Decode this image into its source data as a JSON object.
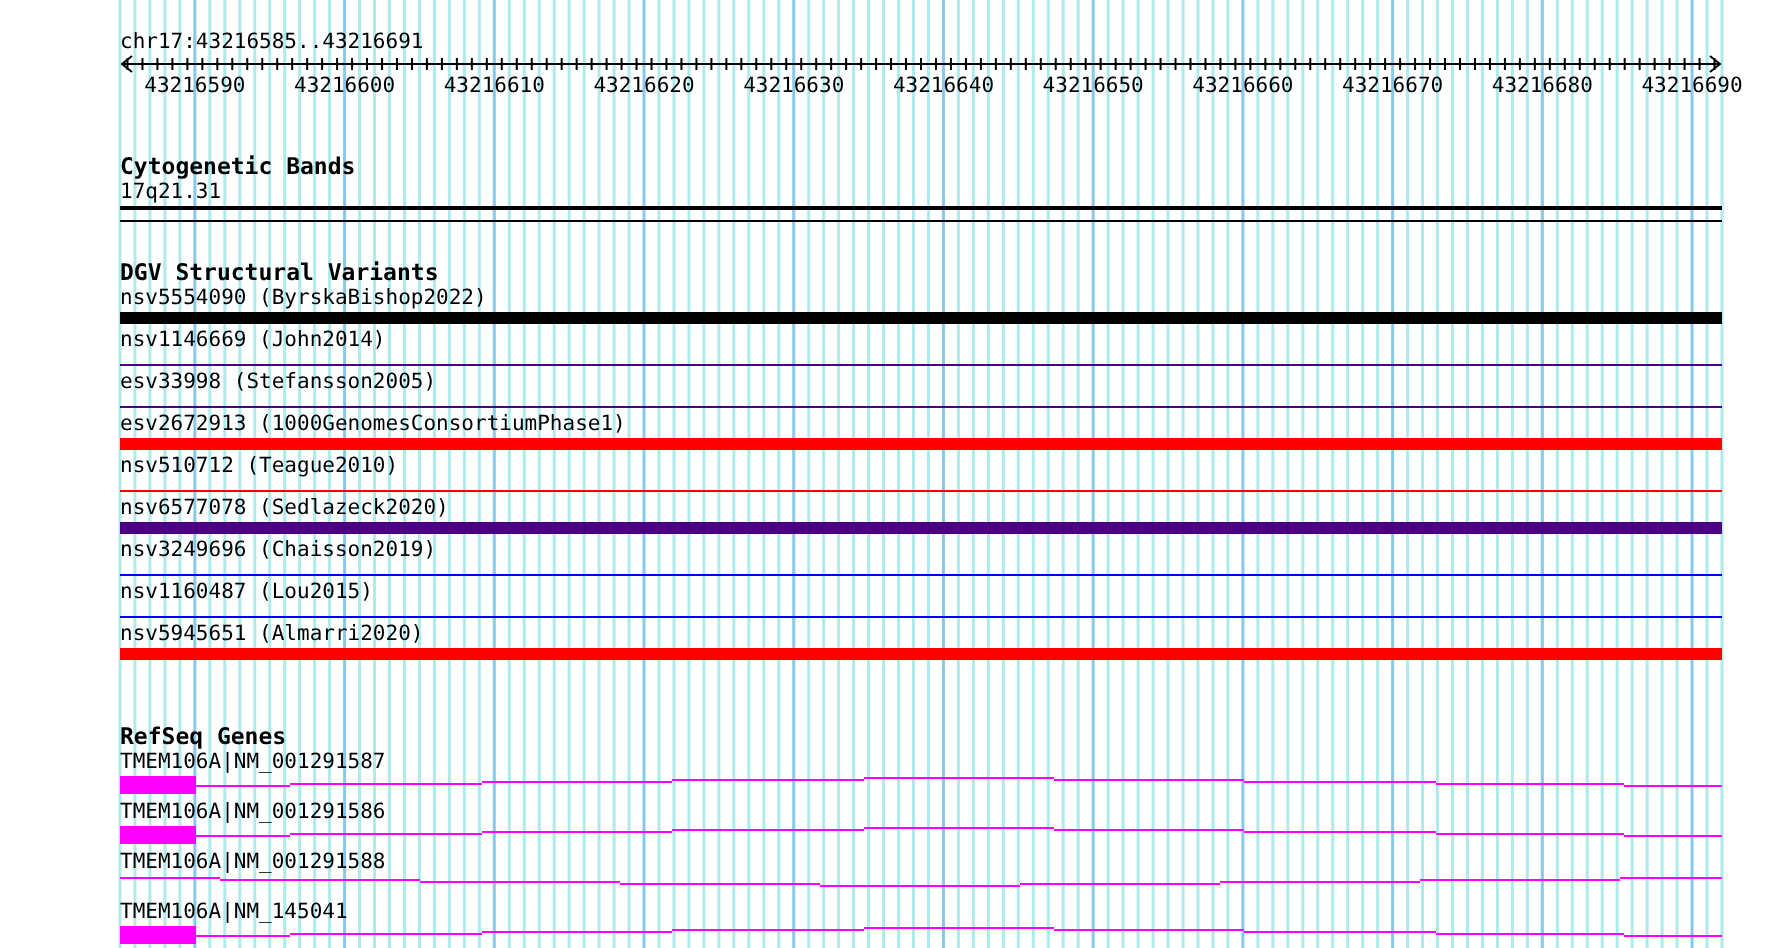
{
  "ruler": {
    "location": "chr17:43216585..43216691",
    "ticks": [
      "43216590",
      "43216600",
      "43216610",
      "43216620",
      "43216630",
      "43216640",
      "43216650",
      "43216660",
      "43216670",
      "43216680",
      "43216690"
    ]
  },
  "tracks": [
    {
      "kind": "bands",
      "title": "Cytogenetic Bands",
      "features": [
        {
          "label": "17q21.31",
          "color": "#000000"
        }
      ]
    },
    {
      "kind": "variants",
      "title": "DGV Structural Variants",
      "features": [
        {
          "label": "nsv5554090 (ByrskaBishop2022)",
          "color": "#000000",
          "thick": true
        },
        {
          "label": "nsv1146669 (John2014)",
          "color": "#4b0082",
          "thick": false
        },
        {
          "label": "esv33998 (Stefansson2005)",
          "color": "#4b0082",
          "thick": false
        },
        {
          "label": "esv2672913 (1000GenomesConsortiumPhase1)",
          "color": "#ff0000",
          "thick": true
        },
        {
          "label": "nsv510712 (Teague2010)",
          "color": "#ff0000",
          "thick": false
        },
        {
          "label": "nsv6577078 (Sedlazeck2020)",
          "color": "#4b0082",
          "thick": true
        },
        {
          "label": "nsv3249696 (Chaisson2019)",
          "color": "#0000ff",
          "thick": false
        },
        {
          "label": "nsv1160487 (Lou2015)",
          "color": "#0000ff",
          "thick": false
        },
        {
          "label": "nsv5945651 (Almarri2020)",
          "color": "#ff0000",
          "thick": true
        }
      ]
    },
    {
      "kind": "genes",
      "title": "RefSeq Genes",
      "features": [
        {
          "label": "TMEM106A|NM_001291587",
          "color": "#ff00ff",
          "exon": true
        },
        {
          "label": "TMEM106A|NM_001291586",
          "color": "#ff00ff",
          "exon": true
        },
        {
          "label": "TMEM106A|NM_001291588",
          "color": "#ff00ff",
          "exon": false
        },
        {
          "label": "TMEM106A|NM_145041",
          "color": "#ff00ff",
          "exon": true
        }
      ]
    }
  ]
}
